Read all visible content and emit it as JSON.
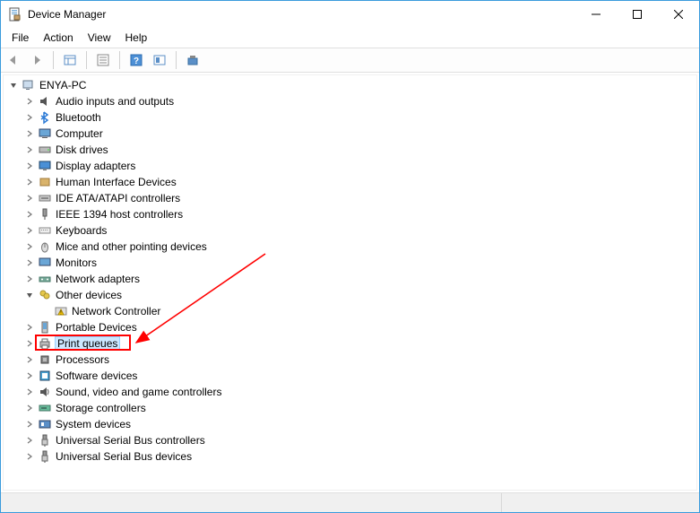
{
  "window": {
    "title": "Device Manager"
  },
  "menu": {
    "file": "File",
    "action": "Action",
    "view": "View",
    "help": "Help"
  },
  "root": {
    "name": "ENYA-PC"
  },
  "categories": [
    {
      "label": "Audio inputs and outputs",
      "icon": "audio"
    },
    {
      "label": "Bluetooth",
      "icon": "bluetooth"
    },
    {
      "label": "Computer",
      "icon": "computer"
    },
    {
      "label": "Disk drives",
      "icon": "disk"
    },
    {
      "label": "Display adapters",
      "icon": "display"
    },
    {
      "label": "Human Interface Devices",
      "icon": "hid"
    },
    {
      "label": "IDE ATA/ATAPI controllers",
      "icon": "ide"
    },
    {
      "label": "IEEE 1394 host controllers",
      "icon": "1394"
    },
    {
      "label": "Keyboards",
      "icon": "keyboard"
    },
    {
      "label": "Mice and other pointing devices",
      "icon": "mouse"
    },
    {
      "label": "Monitors",
      "icon": "monitor"
    },
    {
      "label": "Network adapters",
      "icon": "network"
    },
    {
      "label": "Other devices",
      "icon": "other",
      "expanded": true,
      "children": [
        {
          "label": "Network Controller",
          "icon": "warn"
        }
      ]
    },
    {
      "label": "Portable Devices",
      "icon": "portable"
    },
    {
      "label": "Print queues",
      "icon": "printer",
      "highlighted": true,
      "selected": true
    },
    {
      "label": "Processors",
      "icon": "cpu"
    },
    {
      "label": "Software devices",
      "icon": "software"
    },
    {
      "label": "Sound, video and game controllers",
      "icon": "sound"
    },
    {
      "label": "Storage controllers",
      "icon": "storage"
    },
    {
      "label": "System devices",
      "icon": "system"
    },
    {
      "label": "Universal Serial Bus controllers",
      "icon": "usb"
    },
    {
      "label": "Universal Serial Bus devices",
      "icon": "usb"
    }
  ]
}
